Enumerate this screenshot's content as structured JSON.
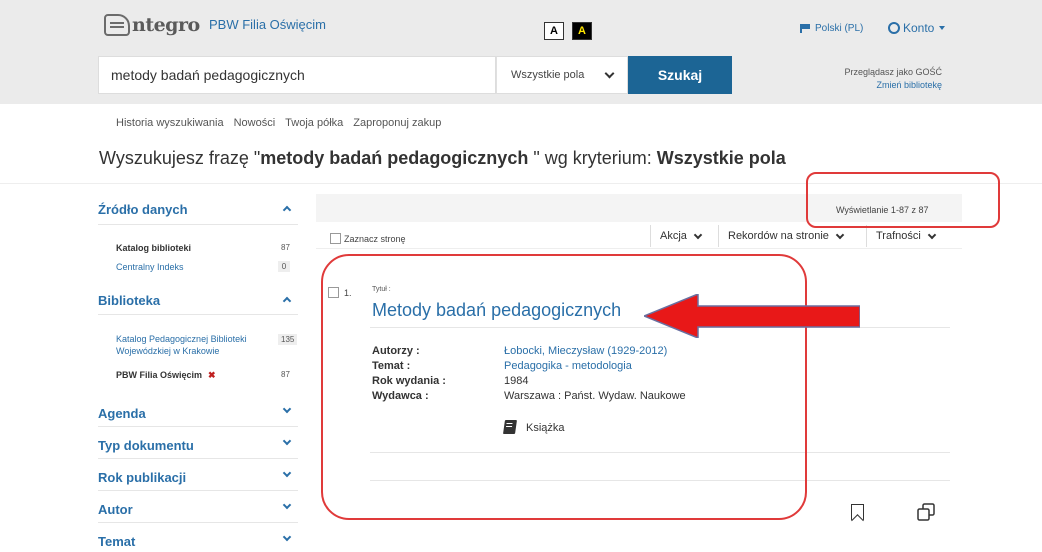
{
  "header": {
    "logo_text": "ntegro",
    "branch": "PBW Filia Oświęcim",
    "contrast_normal": "A",
    "contrast_high": "A",
    "language": "Polski (PL)",
    "account": "Konto",
    "guest_line1": "Przeglądasz jako GOŚĆ",
    "guest_line2": "Zmień bibliotekę"
  },
  "search": {
    "query": "metody badań pedagogicznych",
    "field": "Wszystkie pola",
    "button": "Szukaj"
  },
  "subnav": [
    "Historia wyszukiwania",
    "Nowości",
    "Twoja półka",
    "Zaproponuj zakup"
  ],
  "phrase": {
    "prefix": "Wyszukujesz frazę \"",
    "query": "metody badań pedagogicznych",
    "middle": " \" wg kryterium: ",
    "criterion": "Wszystkie pola"
  },
  "sidebar": {
    "source_title": "Źródło danych",
    "source_items": [
      {
        "label": "Katalog biblioteki",
        "count": "87"
      },
      {
        "label": "Centralny Indeks",
        "count": "0"
      }
    ],
    "library_title": "Biblioteka",
    "library_items": [
      {
        "label": "Katalog Pedagogicznej Biblioteki Wojewódzkiej w Krakowie",
        "count": "135"
      },
      {
        "label": "PBW Filia Oświęcim",
        "count": "87"
      }
    ],
    "collapsed": [
      "Agenda",
      "Typ dokumentu",
      "Rok publikacji",
      "Autor",
      "Temat"
    ]
  },
  "results": {
    "display_info": "Wyświetlanie 1-87 z 87",
    "select_page": "Zaznacz stronę",
    "action": "Akcja",
    "per_page": "Rekordów na stronie",
    "sort": "Trafności"
  },
  "record": {
    "number": "1.",
    "title_label": "Tytuł :",
    "title": "Metody badań pedagogicznych",
    "labels": [
      "Autorzy :",
      "Temat :",
      "Rok wydania :",
      "Wydawca :"
    ],
    "values": [
      "Łobocki, Mieczysław (1929-2012)",
      "Pedagogika - metodologia",
      "1984",
      "Warszawa : Państ. Wydaw. Naukowe"
    ],
    "type": "Książka"
  },
  "colors": {
    "accent": "#1c6595",
    "link": "#2a6fa8",
    "annotation": "#e03a3a"
  }
}
